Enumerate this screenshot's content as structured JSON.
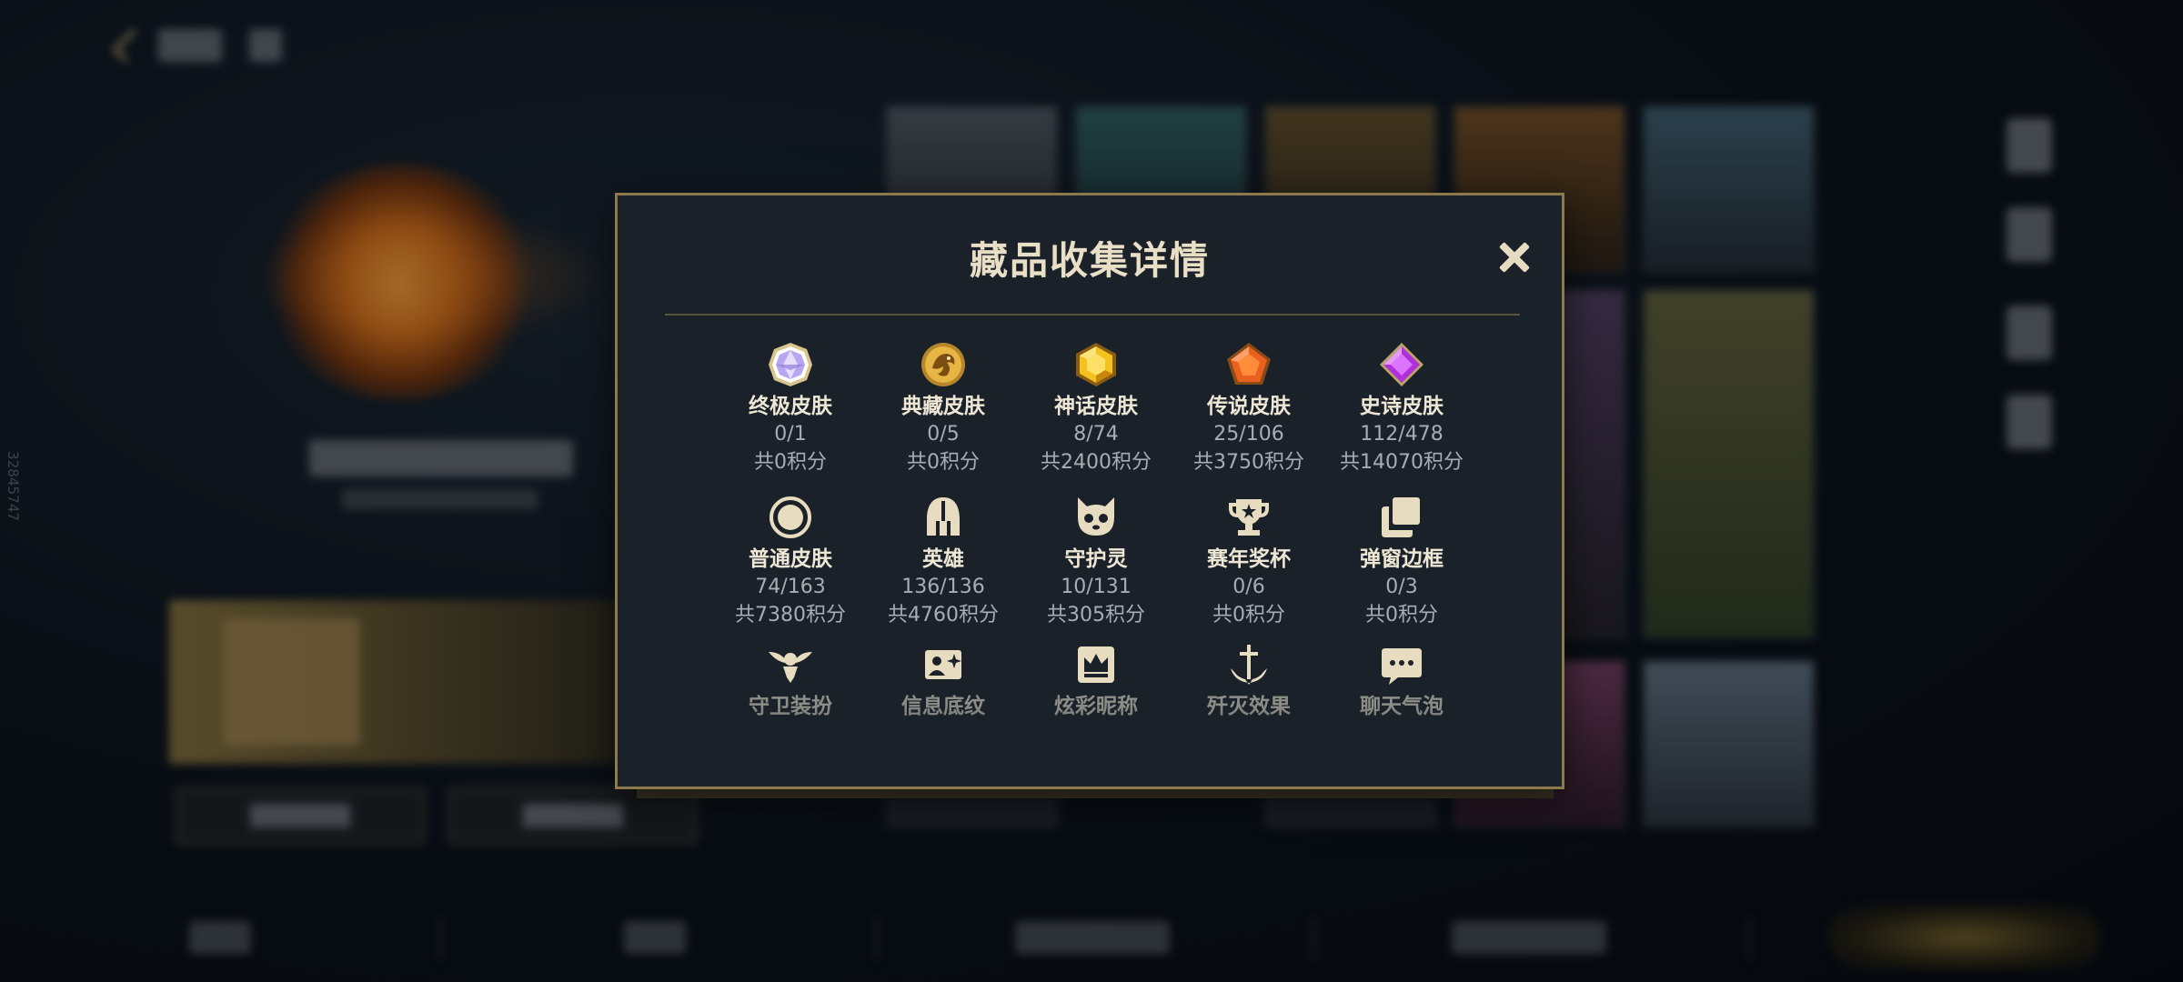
{
  "background": {
    "vertical_id": "32845747"
  },
  "modal": {
    "title": "藏品收集详情",
    "categories": [
      {
        "name": "终极皮肤",
        "count": "0/1",
        "points": "共0积分",
        "icon": "ultimate-gem-icon"
      },
      {
        "name": "典藏皮肤",
        "count": "0/5",
        "points": "共0积分",
        "icon": "dragon-medal-icon"
      },
      {
        "name": "神话皮肤",
        "count": "8/74",
        "points": "共2400积分",
        "icon": "mythic-gem-icon"
      },
      {
        "name": "传说皮肤",
        "count": "25/106",
        "points": "共3750积分",
        "icon": "legendary-gem-icon"
      },
      {
        "name": "史诗皮肤",
        "count": "112/478",
        "points": "共14070积分",
        "icon": "epic-gem-icon"
      },
      {
        "name": "普通皮肤",
        "count": "74/163",
        "points": "共7380积分",
        "icon": "circle-icon"
      },
      {
        "name": "英雄",
        "count": "136/136",
        "points": "共4760积分",
        "icon": "helmet-icon"
      },
      {
        "name": "守护灵",
        "count": "10/131",
        "points": "共305积分",
        "icon": "guardian-pet-icon"
      },
      {
        "name": "赛年奖杯",
        "count": "0/6",
        "points": "共0积分",
        "icon": "trophy-icon"
      },
      {
        "name": "弹窗边框",
        "count": "0/3",
        "points": "共0积分",
        "icon": "frame-icon"
      },
      {
        "name": "守卫装扮",
        "icon": "ward-icon"
      },
      {
        "name": "信息底纹",
        "icon": "card-pattern-icon"
      },
      {
        "name": "炫彩昵称",
        "icon": "crown-nameplate-icon"
      },
      {
        "name": "歼灭效果",
        "icon": "anchor-icon"
      },
      {
        "name": "聊天气泡",
        "icon": "chat-bubble-icon"
      }
    ]
  },
  "colors": {
    "accent_gold": "#8c7a4c",
    "title_text": "#e9dfc7",
    "panel_bg": "#1a2129"
  }
}
